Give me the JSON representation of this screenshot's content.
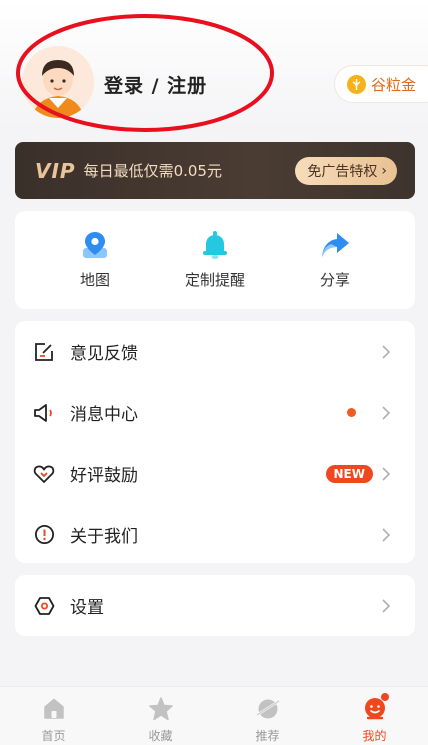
{
  "header": {
    "login_label": "登录 / 注册",
    "coin_label": "谷粒金",
    "coin_icon": "coin-icon",
    "annotation_color": "#e8101e"
  },
  "vip": {
    "logo": "VIP",
    "description": "每日最低仅需0.05元",
    "button_label": "免广告特权",
    "button_chevron": "›"
  },
  "quick_actions": [
    {
      "label": "地图",
      "icon": "map-pin-icon"
    },
    {
      "label": "定制提醒",
      "icon": "bell-icon"
    },
    {
      "label": "分享",
      "icon": "share-arrow-icon"
    }
  ],
  "menu": {
    "items": [
      {
        "label": "意见反馈",
        "icon": "edit-box-icon"
      },
      {
        "label": "消息中心",
        "icon": "speaker-icon",
        "indicator": "dot"
      },
      {
        "label": "好评鼓励",
        "icon": "heart-outline-icon",
        "badge": "NEW"
      },
      {
        "label": "关于我们",
        "icon": "info-circle-icon"
      }
    ],
    "settings": {
      "label": "设置",
      "icon": "hexagon-settings-icon"
    }
  },
  "bottom_nav": [
    {
      "label": "首页",
      "icon": "home-icon",
      "active": false
    },
    {
      "label": "收藏",
      "icon": "star-icon",
      "active": false
    },
    {
      "label": "推荐",
      "icon": "planet-icon",
      "active": false
    },
    {
      "label": "我的",
      "icon": "profile-face-icon",
      "active": true,
      "has_dot": true
    }
  ],
  "colors": {
    "accent": "#f0471f",
    "blue": "#2f8cf0",
    "vip_dark": "#3a302a",
    "vip_gold": "#e8c49a"
  }
}
